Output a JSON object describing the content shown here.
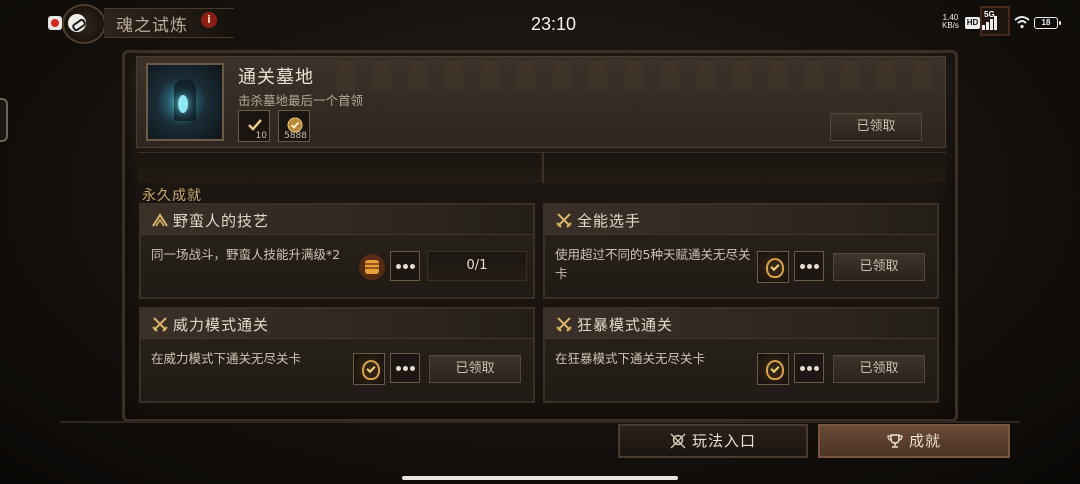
{
  "status_bar": {
    "time": "23:10",
    "net_speed_value": "1.40",
    "net_speed_unit": "KB/s",
    "hd_label": "HD",
    "network_label": "5G",
    "battery": "18"
  },
  "window": {
    "title": "魂之试炼",
    "info_glyph": "i"
  },
  "header": {
    "title": "通关墓地",
    "description": "击杀墓地最后一个首领",
    "rewards": [
      {
        "icon": "xp-check-icon",
        "count": "10"
      },
      {
        "icon": "gold-coin-icon",
        "count": "5888"
      }
    ],
    "claimed_label": "已领取"
  },
  "section": {
    "label": "永久成就"
  },
  "achievements": [
    {
      "title": "野蛮人的技艺",
      "icon": "barbarian-axes-icon",
      "description": "同一场战斗，野蛮人技能升满级*2",
      "progress": "0/1",
      "reward_icon": "fist-flame-icon",
      "more_label": "•••"
    },
    {
      "title": "全能选手",
      "icon": "crossed-swords-icon",
      "description": "使用超过不同的5种天赋通关无尽关卡",
      "claimed_label": "已领取",
      "reward_icon": "medal-icon",
      "more_label": "•••"
    },
    {
      "title": "威力模式通关",
      "icon": "crossed-swords-icon",
      "description": "在威力模式下通关无尽关卡",
      "claimed_label": "已领取",
      "reward_icon": "medal-icon",
      "more_label": "•••"
    },
    {
      "title": "狂暴模式通关",
      "icon": "crossed-swords-icon",
      "description": "在狂暴模式下通关无尽关卡",
      "claimed_label": "已领取",
      "reward_icon": "medal-icon",
      "more_label": "•••"
    }
  ],
  "tabs": [
    {
      "label": "玩法入口",
      "icon": "skull-crossbones-icon",
      "active": false
    },
    {
      "label": "成就",
      "icon": "trophy-icon",
      "active": true
    }
  ],
  "colors": {
    "accent_gold": "#c6a769",
    "active_tab": "#6a4a36",
    "panel": "#2b241d"
  }
}
